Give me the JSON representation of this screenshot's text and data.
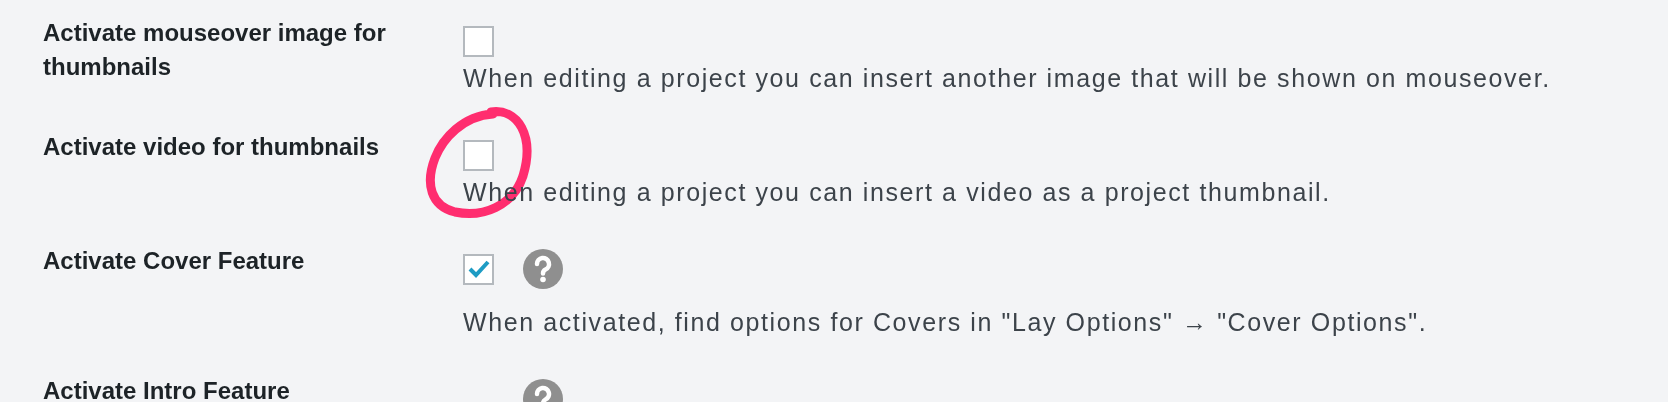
{
  "settings": [
    {
      "label": "Activate mouseover image for thumbnails",
      "checked": false,
      "help": false,
      "circled": false,
      "description": "When editing a project you can insert another image that will be shown on mouseover."
    },
    {
      "label": "Activate video for thumbnails",
      "checked": false,
      "help": false,
      "circled": true,
      "description": "When editing a project you can insert a video as a project thumbnail."
    },
    {
      "label": "Activate Cover Feature",
      "checked": true,
      "help": true,
      "circled": false,
      "description": "When activated, find options for Covers in \"Lay Options\" → \"Cover Options\"."
    },
    {
      "label": "Activate Intro Feature",
      "help": true,
      "circled": false
    }
  ]
}
